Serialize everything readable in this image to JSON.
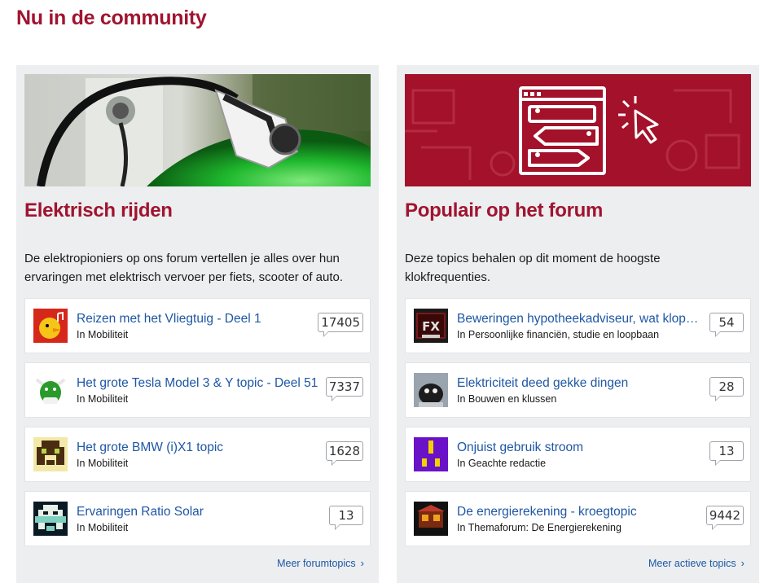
{
  "page": {
    "title": "Nu in de community"
  },
  "panels": [
    {
      "title": "Elektrisch rijden",
      "description": "De elektropioniers op ons forum vertellen je alles over hun ervaringen met elektrisch vervoer per fiets, scooter of auto.",
      "topics": [
        {
          "title": "Reizen met het Vliegtuig - Deel 1",
          "category": "In Mobiliteit",
          "count": "17405"
        },
        {
          "title": "Het grote Tesla Model 3 & Y topic - Deel 51",
          "category": "In Mobiliteit",
          "count": "7337"
        },
        {
          "title": "Het grote BMW (i)X1 topic",
          "category": "In Mobiliteit",
          "count": "1628"
        },
        {
          "title": "Ervaringen Ratio Solar",
          "category": "In Mobiliteit",
          "count": "13"
        }
      ],
      "more_link": "Meer forumtopics"
    },
    {
      "title": "Populair op het forum",
      "description": "Deze topics behalen op dit moment de hoogste klokfrequenties.",
      "topics": [
        {
          "title": "Beweringen hypotheekadviseur, wat klopt er van?",
          "category": "In Persoonlijke financiën, studie en loopbaan",
          "count": "54"
        },
        {
          "title": "Elektriciteit deed gekke dingen",
          "category": "In Bouwen en klussen",
          "count": "28"
        },
        {
          "title": "Onjuist gebruik stroom",
          "category": "In Geachte redactie",
          "count": "13"
        },
        {
          "title": "De energierekening - kroegtopic",
          "category": "In Themaforum: De Energierekening",
          "count": "9442"
        }
      ],
      "more_link": "Meer actieve topics"
    }
  ],
  "icons": {
    "more_chevron": "›"
  },
  "colors": {
    "accent": "#a0142f",
    "link": "#1f57a4",
    "panel_bg": "#eceef0"
  }
}
